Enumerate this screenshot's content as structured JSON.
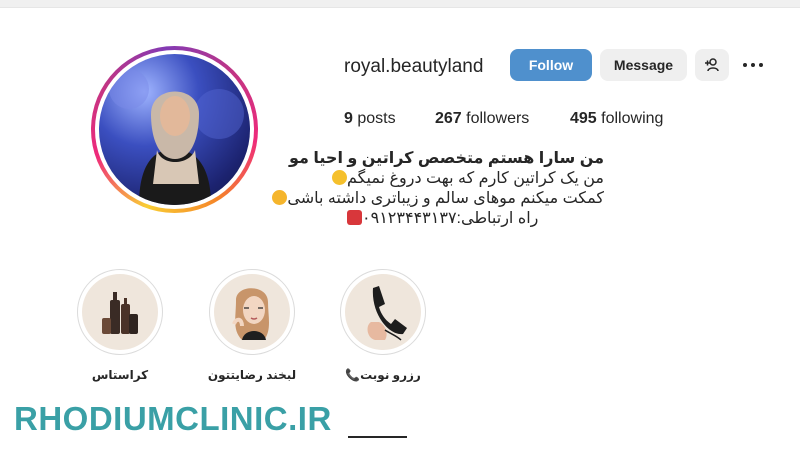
{
  "profile": {
    "username": "royal.beautyland",
    "follow_label": "Follow",
    "message_label": "Message",
    "add_user_icon": "add-user-icon",
    "more_icon": "more-options-icon"
  },
  "stats": {
    "posts_count": "9",
    "posts_label": "posts",
    "followers_count": "267",
    "followers_label": "followers",
    "following_count": "495",
    "following_label": "following"
  },
  "bio": {
    "title": "من سارا هستم متخصص کراتین و احیا مو",
    "line1": "من یک کراتین کارم که بهت دروغ نمیگم",
    "line2": "کمکت میکنم موهای سالم و زیباتری داشته باشی",
    "line3": "راه ارتباطی:۰۹۱۲۳۴۴۳۱۳۷"
  },
  "highlights": [
    {
      "label": "کراستاس",
      "icon": "hair-products-icon"
    },
    {
      "label": "لبخند رضایتتون",
      "icon": "woman-portrait-icon"
    },
    {
      "label": "رزرو نوبت📞",
      "icon": "phone-hand-icon"
    }
  ],
  "watermark": "RHODIUMCLINIC.IR",
  "colors": {
    "follow_button": "#4f90cd",
    "secondary_button": "#efefef",
    "watermark": "#3aa0a6"
  }
}
